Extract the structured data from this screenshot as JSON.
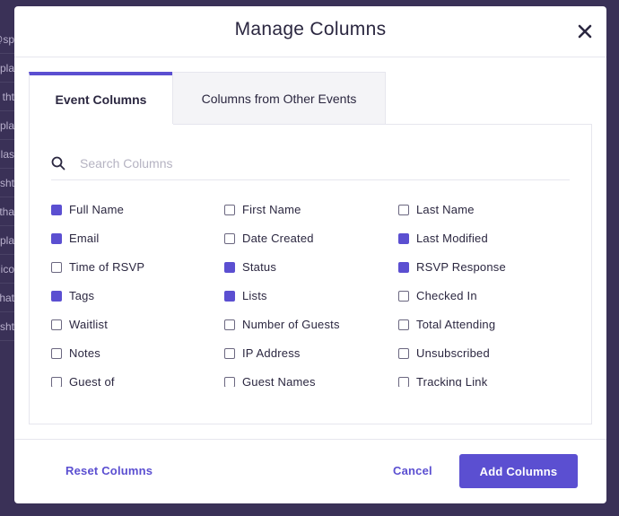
{
  "background_rows": [
    "@sp",
    "pla",
    "tht",
    "pla",
    "las",
    "sht",
    "tha",
    "pla",
    "ico",
    "hat",
    "sht"
  ],
  "modal": {
    "title": "Manage Columns",
    "close_icon": "close-icon"
  },
  "tabs": [
    {
      "label": "Event Columns",
      "active": true
    },
    {
      "label": "Columns from Other Events",
      "active": false
    }
  ],
  "search": {
    "placeholder": "Search Columns",
    "value": "",
    "icon": "search-icon"
  },
  "columns": [
    [
      {
        "label": "Full Name",
        "checked": true
      },
      {
        "label": "Email",
        "checked": true
      },
      {
        "label": "Time of RSVP",
        "checked": false
      },
      {
        "label": "Tags",
        "checked": true
      },
      {
        "label": "Waitlist",
        "checked": false
      },
      {
        "label": "Notes",
        "checked": false
      },
      {
        "label": "Guest of",
        "checked": false
      }
    ],
    [
      {
        "label": "First Name",
        "checked": false
      },
      {
        "label": "Date Created",
        "checked": false
      },
      {
        "label": "Status",
        "checked": true
      },
      {
        "label": "Lists",
        "checked": true
      },
      {
        "label": "Number of Guests",
        "checked": false
      },
      {
        "label": "IP Address",
        "checked": false
      },
      {
        "label": "Guest Names",
        "checked": false
      }
    ],
    [
      {
        "label": "Last Name",
        "checked": false
      },
      {
        "label": "Last Modified",
        "checked": true
      },
      {
        "label": "RSVP Response",
        "checked": true
      },
      {
        "label": "Checked In",
        "checked": false
      },
      {
        "label": "Total Attending",
        "checked": false
      },
      {
        "label": "Unsubscribed",
        "checked": false
      },
      {
        "label": "Tracking Link",
        "checked": false
      }
    ]
  ],
  "footer": {
    "reset_label": "Reset Columns",
    "cancel_label": "Cancel",
    "add_label": "Add Columns"
  },
  "colors": {
    "accent": "#5b4fd1",
    "overlay": "#3a3157",
    "text": "#2b2740"
  }
}
